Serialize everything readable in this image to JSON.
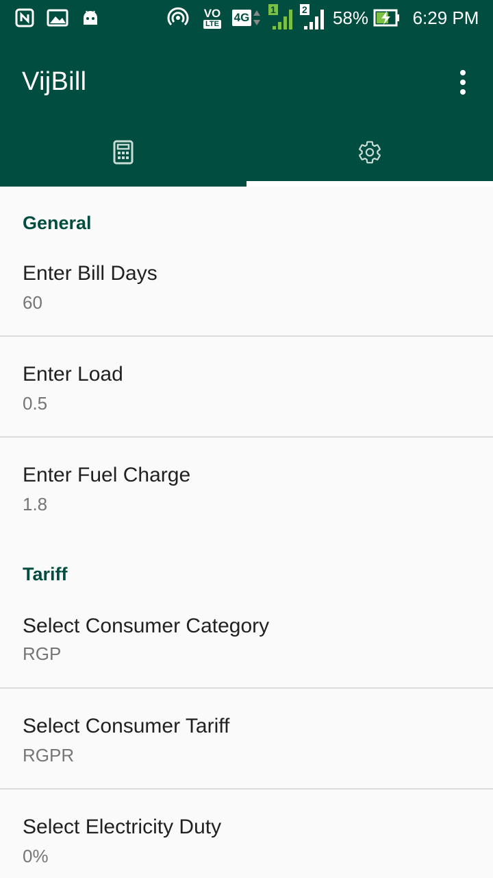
{
  "status_bar": {
    "battery_percent": "58%",
    "time": "6:29 PM",
    "volte_label": "VO",
    "lte_label": "LTE",
    "network_type": "4G",
    "sim1_label": "1",
    "sim2_label": "2",
    "icons": [
      "nfc-icon",
      "gallery-icon",
      "android-icon",
      "hotspot-icon",
      "volte-icon",
      "network-4g-icon",
      "signal-sim1-icon",
      "signal-sim2-icon",
      "battery-charging-icon"
    ]
  },
  "app_bar": {
    "title": "VijBill",
    "menu_icon": "more-vert-icon",
    "tabs": [
      {
        "icon": "calculator-icon",
        "selected": false
      },
      {
        "icon": "settings-icon",
        "selected": true
      }
    ]
  },
  "colors": {
    "primary_dark": "#014d3f",
    "section_header": "#014d3f",
    "background": "#fafafa",
    "title_text": "#212121",
    "summary_text": "#757575"
  },
  "settings": {
    "general": {
      "header": "General",
      "bill_days": {
        "title": "Enter Bill Days",
        "value": "60"
      },
      "load": {
        "title": "Enter Load",
        "value": "0.5"
      },
      "fuel_charge": {
        "title": "Enter Fuel Charge",
        "value": "1.8"
      }
    },
    "tariff": {
      "header": "Tariff",
      "consumer_category": {
        "title": "Select Consumer Category",
        "value": "RGP"
      },
      "consumer_tariff": {
        "title": "Select Consumer Tariff",
        "value": "RGPR"
      },
      "electricity_duty": {
        "title": "Select Electricity Duty",
        "value": "0%"
      }
    }
  }
}
